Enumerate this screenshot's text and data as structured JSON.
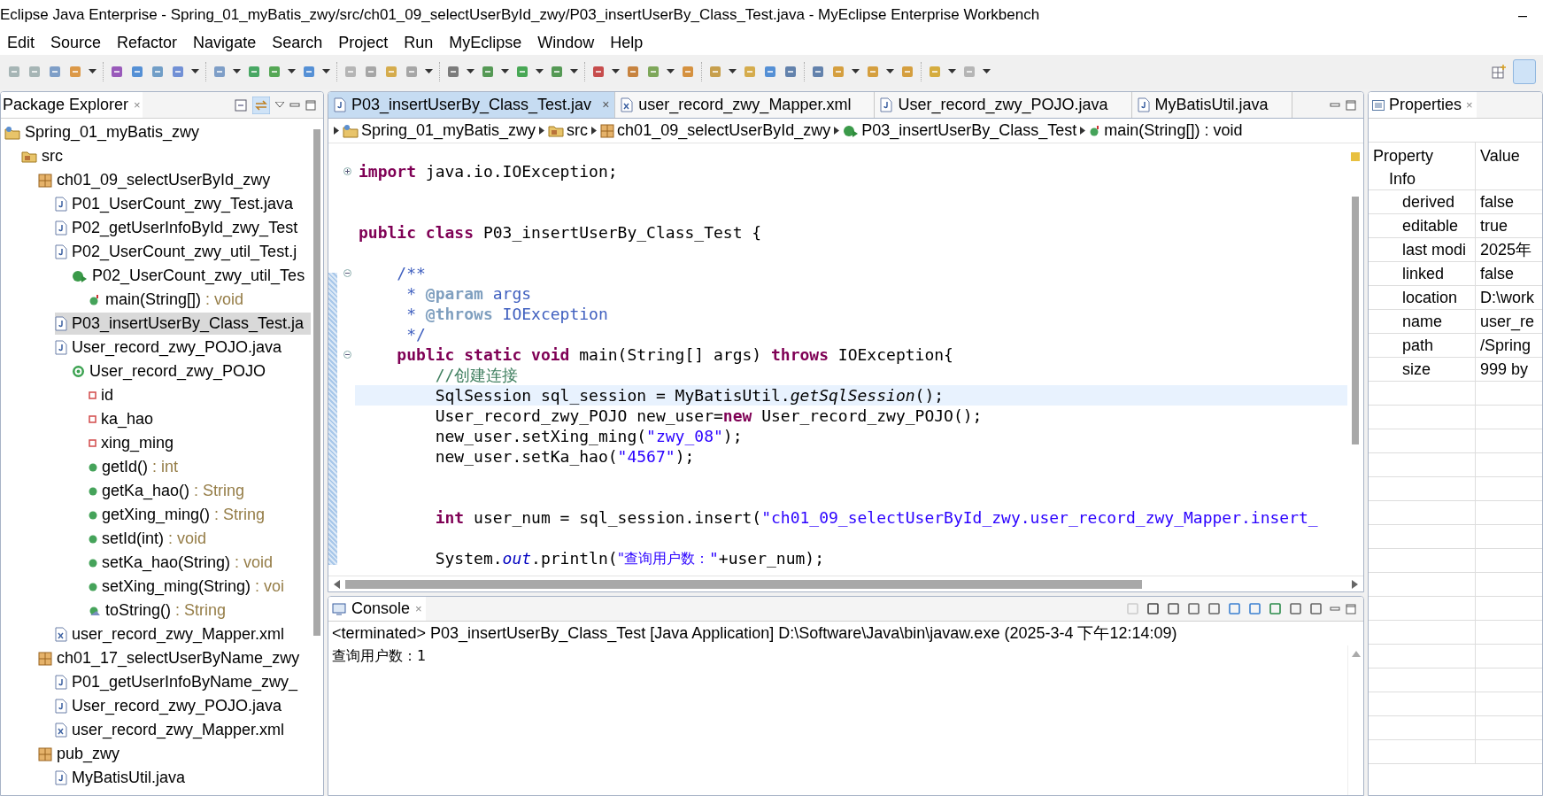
{
  "window": {
    "title": "Eclipse Java Enterprise - Spring_01_myBatis_zwy/src/ch01_09_selectUserById_zwy/P03_insertUserBy_Class_Test.java - MyEclipse Enterprise Workbench",
    "minimize": "–"
  },
  "menu": [
    "Edit",
    "Source",
    "Refactor",
    "Navigate",
    "Search",
    "Project",
    "Run",
    "MyEclipse",
    "Window",
    "Help"
  ],
  "package_explorer": {
    "title": "Package Explorer",
    "close": "×",
    "tree": [
      {
        "label": "Spring_01_myBatis_zwy",
        "kind": "project",
        "selected": false,
        "children": [
          {
            "label": "src",
            "kind": "folder",
            "selected": false,
            "children": [
              {
                "label": "ch01_09_selectUserById_zwy",
                "kind": "package",
                "selected": false,
                "children": [
                  {
                    "label": "P01_UserCount_zwy_Test.java",
                    "kind": "java",
                    "selected": false
                  },
                  {
                    "label": "P02_getUserInfoById_zwy_Test",
                    "kind": "java",
                    "selected": false
                  },
                  {
                    "label": "P02_UserCount_zwy_util_Test.j",
                    "kind": "java",
                    "selected": false,
                    "children": [
                      {
                        "label": "P02_UserCount_zwy_util_Tes",
                        "kind": "runclass",
                        "selected": false,
                        "children": [
                          {
                            "label": "main(String[])",
                            "type": " : void",
                            "kind": "static_method",
                            "selected": false
                          }
                        ]
                      }
                    ]
                  },
                  {
                    "label": "P03_insertUserBy_Class_Test.ja",
                    "kind": "java",
                    "selected": true
                  },
                  {
                    "label": "User_record_zwy_POJO.java",
                    "kind": "java",
                    "selected": false,
                    "children": [
                      {
                        "label": "User_record_zwy_POJO",
                        "kind": "class",
                        "selected": false,
                        "children": [
                          {
                            "label": "id",
                            "kind": "field",
                            "selected": false
                          },
                          {
                            "label": "ka_hao",
                            "kind": "field",
                            "selected": false
                          },
                          {
                            "label": "xing_ming",
                            "kind": "field",
                            "selected": false
                          },
                          {
                            "label": "getId()",
                            "type": " : int",
                            "kind": "method",
                            "selected": false
                          },
                          {
                            "label": "getKa_hao()",
                            "type": " : String",
                            "kind": "method",
                            "selected": false
                          },
                          {
                            "label": "getXing_ming()",
                            "type": " : String",
                            "kind": "method",
                            "selected": false
                          },
                          {
                            "label": "setId(int)",
                            "type": " : void",
                            "kind": "method",
                            "selected": false
                          },
                          {
                            "label": "setKa_hao(String)",
                            "type": " : void",
                            "kind": "method",
                            "selected": false
                          },
                          {
                            "label": "setXing_ming(String)",
                            "type": " : voi",
                            "kind": "method",
                            "selected": false
                          },
                          {
                            "label": "toString()",
                            "type": " : String",
                            "kind": "override_method",
                            "selected": false
                          }
                        ]
                      }
                    ]
                  },
                  {
                    "label": "user_record_zwy_Mapper.xml",
                    "kind": "xml",
                    "selected": false
                  }
                ]
              },
              {
                "label": "ch01_17_selectUserByName_zwy",
                "kind": "package",
                "selected": false,
                "children": [
                  {
                    "label": "P01_getUserInfoByName_zwy_",
                    "kind": "java",
                    "selected": false
                  },
                  {
                    "label": "User_record_zwy_POJO.java",
                    "kind": "java",
                    "selected": false
                  },
                  {
                    "label": "user_record_zwy_Mapper.xml",
                    "kind": "xml",
                    "selected": false
                  }
                ]
              },
              {
                "label": "pub_zwy",
                "kind": "package",
                "selected": false,
                "children": [
                  {
                    "label": "MyBatisUtil.java",
                    "kind": "java",
                    "selected": false
                  }
                ]
              }
            ]
          }
        ]
      }
    ]
  },
  "editor": {
    "tabs": [
      {
        "label": "P03_insertUserBy_Class_Test.jav",
        "kind": "java",
        "selected": true,
        "close": "×"
      },
      {
        "label": "user_record_zwy_Mapper.xml",
        "kind": "xml",
        "selected": false
      },
      {
        "label": "User_record_zwy_POJO.java",
        "kind": "java",
        "selected": false
      },
      {
        "label": "MyBatisUtil.java",
        "kind": "java",
        "selected": false
      }
    ],
    "breadcrumb": [
      {
        "label": "Spring_01_myBatis_zwy",
        "kind": "project"
      },
      {
        "label": "src",
        "kind": "folder"
      },
      {
        "label": "ch01_09_selectUserById_zwy",
        "kind": "package"
      },
      {
        "label": "P03_insertUserBy_Class_Test",
        "kind": "runclass"
      },
      {
        "label": "main(String[]) : void",
        "kind": "static_method"
      }
    ],
    "lines": [
      {
        "current": false,
        "folded": true,
        "segments": [
          {
            "kind": "keyword",
            "text": "import "
          },
          {
            "kind": "plain",
            "text": "java.io.IOException;"
          }
        ]
      },
      {
        "current": false
      },
      {
        "current": false
      },
      {
        "current": false,
        "segments": [
          {
            "kind": "keyword",
            "text": "public class "
          },
          {
            "kind": "plain",
            "text": "P03_insertUserBy_Class_Test {"
          }
        ]
      },
      {
        "current": false
      },
      {
        "current": false,
        "folded": false,
        "segments": [
          {
            "kind": "javadoc",
            "text": "    /**"
          }
        ]
      },
      {
        "current": false,
        "segments": [
          {
            "kind": "javadoc",
            "text": "     * "
          },
          {
            "kind": "javadoc_tag",
            "text": "@param "
          },
          {
            "kind": "javadoc_ref",
            "text": "args"
          }
        ]
      },
      {
        "current": false,
        "segments": [
          {
            "kind": "javadoc",
            "text": "     * "
          },
          {
            "kind": "javadoc_tag",
            "text": "@throws "
          },
          {
            "kind": "javadoc_ref",
            "text": "IOException"
          }
        ]
      },
      {
        "current": false,
        "segments": [
          {
            "kind": "javadoc",
            "text": "     */"
          }
        ]
      },
      {
        "current": false,
        "folded": false,
        "segments": [
          {
            "kind": "keyword",
            "text": "    public static void "
          },
          {
            "kind": "plain",
            "text": "main(String[] args) "
          },
          {
            "kind": "keyword",
            "text": "throws "
          },
          {
            "kind": "plain",
            "text": "IOException{"
          }
        ]
      },
      {
        "current": false,
        "segments": [
          {
            "kind": "comment",
            "text": "        //创建连接"
          }
        ]
      },
      {
        "current": true,
        "segments": [
          {
            "kind": "plain",
            "text": "        SqlSession sql_session = MyBatisUtil."
          },
          {
            "kind": "italic",
            "text": "getSqlSession"
          },
          {
            "kind": "plain",
            "text": "();"
          }
        ]
      },
      {
        "current": false,
        "segments": [
          {
            "kind": "plain",
            "text": "        User_record_zwy_POJO new_user="
          },
          {
            "kind": "keyword",
            "text": "new "
          },
          {
            "kind": "plain",
            "text": "User_record_zwy_POJO();"
          }
        ]
      },
      {
        "current": false,
        "segments": [
          {
            "kind": "plain",
            "text": "        new_user.setXing_ming("
          },
          {
            "kind": "string",
            "text": "\"zwy_08\""
          },
          {
            "kind": "plain",
            "text": ");"
          }
        ]
      },
      {
        "current": false,
        "segments": [
          {
            "kind": "plain",
            "text": "        new_user.setKa_hao("
          },
          {
            "kind": "string",
            "text": "\"4567\""
          },
          {
            "kind": "plain",
            "text": ");"
          }
        ]
      },
      {
        "current": false
      },
      {
        "current": false
      },
      {
        "current": false,
        "segments": [
          {
            "kind": "keyword",
            "text": "        int "
          },
          {
            "kind": "plain",
            "text": "user_num = sql_session.insert("
          },
          {
            "kind": "string",
            "text": "\"ch01_09_selectUserById_zwy.user_record_zwy_Mapper.insert_"
          }
        ]
      },
      {
        "current": false
      },
      {
        "current": false,
        "segments": [
          {
            "kind": "plain",
            "text": "        System."
          },
          {
            "kind": "static_field",
            "text": "out"
          },
          {
            "kind": "plain",
            "text": ".println("
          },
          {
            "kind": "string_cjk",
            "text": "\"查询用户数："
          },
          {
            "kind": "string",
            "text": "\""
          },
          {
            "kind": "plain",
            "text": "+user_num);"
          }
        ]
      }
    ]
  },
  "console": {
    "title": "Console",
    "close": "×",
    "status": "<terminated> P03_insertUserBy_Class_Test [Java Application] D:\\Software\\Java\\bin\\javaw.exe (2025-3-4 下午12:14:09)",
    "output": "查询用户数：1"
  },
  "properties": {
    "title": "Properties",
    "close": "×",
    "columns": [
      "Property",
      "Value"
    ],
    "group": "Info",
    "rows": [
      {
        "property": "derived",
        "value": "false"
      },
      {
        "property": "editable",
        "value": "true"
      },
      {
        "property": "last modi",
        "value": "2025年"
      },
      {
        "property": "linked",
        "value": "false"
      },
      {
        "property": "location",
        "value": "D:\\work"
      },
      {
        "property": "name",
        "value": "user_re"
      },
      {
        "property": "path",
        "value": "/Spring"
      },
      {
        "property": "size",
        "value": "999  by"
      }
    ]
  }
}
